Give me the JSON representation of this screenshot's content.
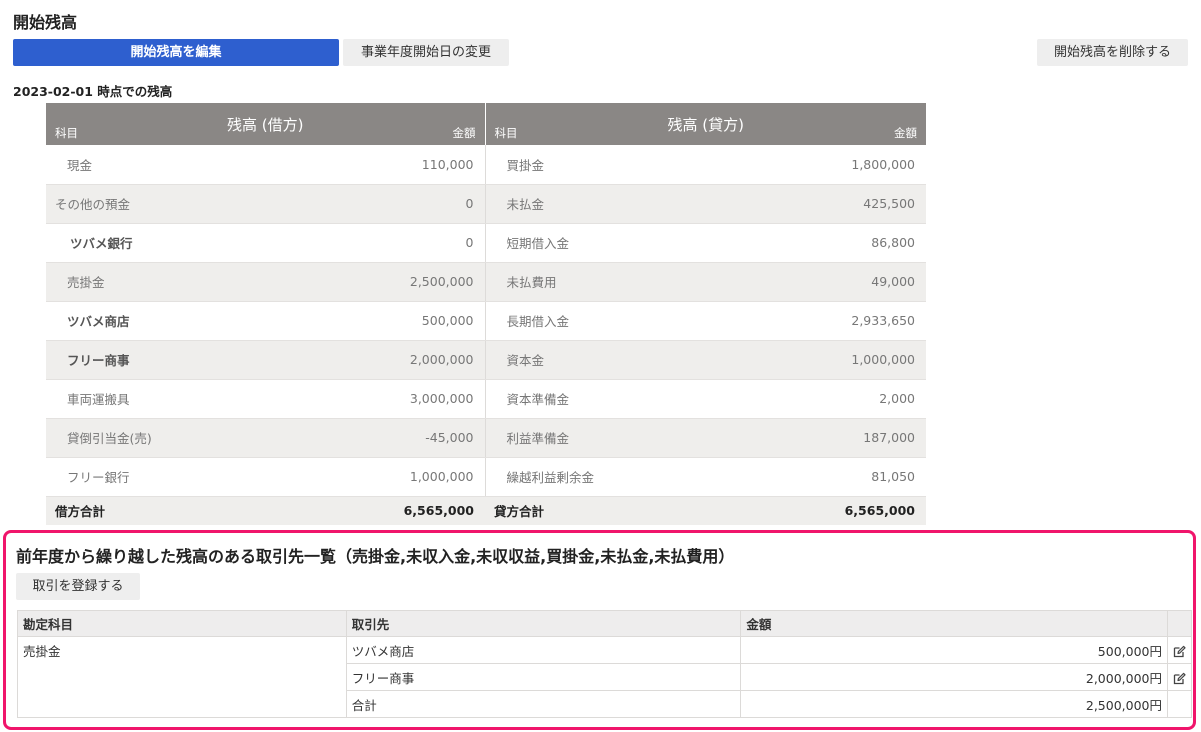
{
  "page": {
    "title": "開始残高",
    "edit_button": "開始残高を編集",
    "change_date_button": "事業年度開始日の変更",
    "delete_button": "開始残高を削除する",
    "as_of": "2023-02-01 時点での残高"
  },
  "balance": {
    "debit_header": "残高 (借方)",
    "credit_header": "残高 (貸方)",
    "account_label": "科目",
    "amount_label": "金額",
    "rows": [
      {
        "d_name": "現金",
        "d_amt": "110,000",
        "c_name": "買掛金",
        "c_amt": "1,800,000"
      },
      {
        "d_name": "その他の預金",
        "d_amt": "0",
        "c_name": "未払金",
        "c_amt": "425,500"
      },
      {
        "d_name": "ツバメ銀行",
        "d_amt": "0",
        "c_name": "短期借入金",
        "c_amt": "86,800"
      },
      {
        "d_name": "売掛金",
        "d_amt": "2,500,000",
        "c_name": "未払費用",
        "c_amt": "49,000"
      },
      {
        "d_name": "ツバメ商店",
        "d_amt": "500,000",
        "c_name": "長期借入金",
        "c_amt": "2,933,650"
      },
      {
        "d_name": "フリー商事",
        "d_amt": "2,000,000",
        "c_name": "資本金",
        "c_amt": "1,000,000"
      },
      {
        "d_name": "車両運搬具",
        "d_amt": "3,000,000",
        "c_name": "資本準備金",
        "c_amt": "2,000"
      },
      {
        "d_name": "貸倒引当金(売)",
        "d_amt": "-45,000",
        "c_name": "利益準備金",
        "c_amt": "187,000"
      },
      {
        "d_name": "フリー銀行",
        "d_amt": "1,000,000",
        "c_name": "繰越利益剰余金",
        "c_amt": "81,050"
      }
    ],
    "debit_total_label": "借方合計",
    "debit_total": "6,565,000",
    "credit_total_label": "貸方合計",
    "credit_total": "6,565,000"
  },
  "counterparties": {
    "title": "前年度から繰り越した残高のある取引先一覧（売掛金,未収入金,未収収益,買掛金,未払金,未払費用）",
    "register_button": "取引を登録する",
    "headers": {
      "account": "勘定科目",
      "partner": "取引先",
      "amount": "金額"
    },
    "account": "売掛金",
    "rows": [
      {
        "partner": "ツバメ商店",
        "amount": "500,000円"
      },
      {
        "partner": "フリー商事",
        "amount": "2,000,000円"
      }
    ],
    "total_label": "合計",
    "total_amount": "2,500,000円"
  },
  "colors": {
    "primary": "#2e5fcf",
    "highlight_border": "#f0156b",
    "table_header": "#8a8785"
  }
}
